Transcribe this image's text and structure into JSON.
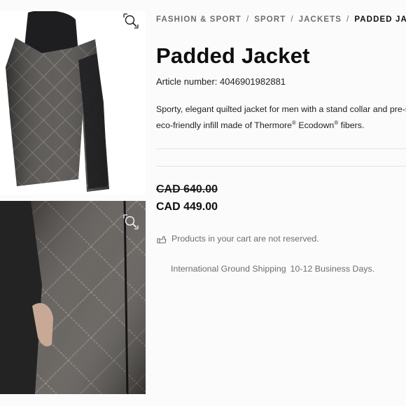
{
  "breadcrumb": {
    "items": [
      "FASHION & SPORT",
      "SPORT",
      "JACKETS"
    ],
    "separator": "/",
    "current": "PADDED JACKET"
  },
  "product": {
    "title": "Padded Jacket",
    "article_label": "Article number:",
    "article_number": "4046901982881",
    "description_line1": "Sporty, elegant quilted jacket for men with a stand collar and pre-sha",
    "description_line2_a": "eco-friendly infill made of Thermore",
    "description_line2_b": " Ecodown",
    "description_line2_c": " fibers.",
    "reg_mark": "®"
  },
  "pricing": {
    "original_price": "CAD 640.00",
    "sale_price": "CAD 449.00"
  },
  "cart_note": "Products in your cart are not reserved.",
  "shipping": {
    "label": "International Ground Shipping",
    "time": "10-12 Business Days."
  },
  "icons": {
    "zoom": "zoom-icon",
    "cart_note": "hand-icon"
  },
  "colors": {
    "text": "#0e0e10",
    "muted": "#6b6e72",
    "divider": "#e3e4e6",
    "jacket": "#4a4744"
  }
}
